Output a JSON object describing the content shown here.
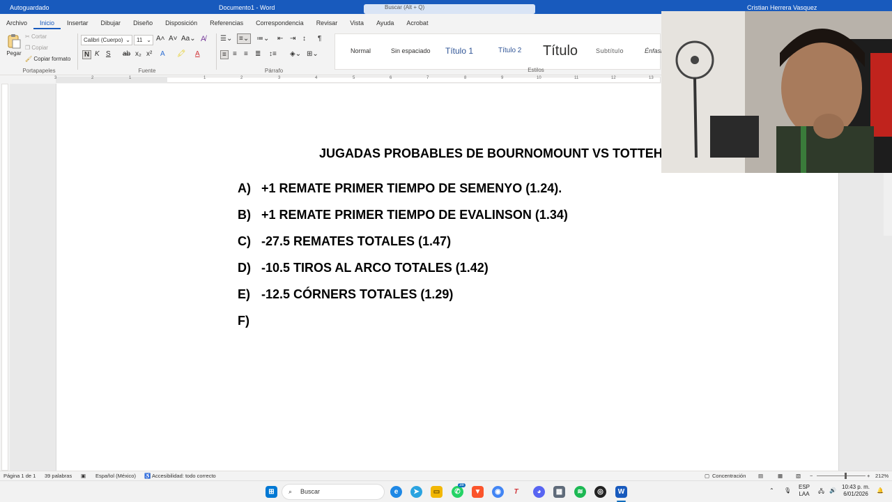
{
  "titlebar": {
    "autosave": "Autoguardado",
    "doc_name": "Documento1 - Word",
    "search_placeholder": "Buscar (Alt + Q)",
    "user": "Cristian Herrera Vasquez"
  },
  "ribbon": {
    "tabs": [
      "Archivo",
      "Inicio",
      "Insertar",
      "Dibujar",
      "Diseño",
      "Disposición",
      "Referencias",
      "Correspondencia",
      "Revisar",
      "Vista",
      "Ayuda",
      "Acrobat"
    ],
    "active_tab": "Inicio",
    "clipboard": {
      "paste": "Pegar",
      "cut": "Cortar",
      "copy": "Copiar",
      "format_painter": "Copiar formato",
      "label": "Portapapeles"
    },
    "font": {
      "family": "Calibri (Cuerpo)",
      "size": "11",
      "label": "Fuente"
    },
    "paragraph": {
      "label": "Párrafo"
    },
    "styles": {
      "label": "Estilos",
      "items": [
        "Normal",
        "Sin espaciado",
        "Título 1",
        "Título 2",
        "Título",
        "Subtítulo",
        "Énfasis"
      ]
    }
  },
  "ruler": {
    "numbers": [
      "3",
      "2",
      "1",
      "1",
      "2",
      "3",
      "4",
      "5",
      "6",
      "7",
      "8",
      "9",
      "10",
      "11",
      "12",
      "13"
    ]
  },
  "document": {
    "title": "JUGADAS PROBABLES DE BOURNOMOUNT VS TOTTEHAM",
    "items": [
      {
        "letter": "A)",
        "text": "+1 REMATE PRIMER TIEMPO DE SEMENYO (1.24)."
      },
      {
        "letter": "B)",
        "text": "+1 REMATE PRIMER TIEMPO DE EVALINSON (1.34)"
      },
      {
        "letter": "C)",
        "text": "-27.5 REMATES TOTALES (1.47)"
      },
      {
        "letter": "D)",
        "text": "-10.5 TIROS AL ARCO TOTALES (1.42)"
      },
      {
        "letter": "E)",
        "text": "-12.5 CÓRNERS TOTALES (1.29)"
      },
      {
        "letter": "F)",
        "text": ""
      }
    ]
  },
  "statusbar": {
    "page": "Página 1 de 1",
    "words": "39 palabras",
    "language": "Español (México)",
    "accessibility": "Accesibilidad: todo correcto",
    "focus": "Concentración",
    "zoom": "212%"
  },
  "taskbar": {
    "search": "Buscar",
    "whatsapp_badge": "38",
    "lang_1": "ESP",
    "lang_2": "LAA",
    "time": "10:43 p. m.",
    "date": "6/01/2026"
  },
  "colors": {
    "word_blue": "#185abd",
    "accent": "#185abd"
  }
}
